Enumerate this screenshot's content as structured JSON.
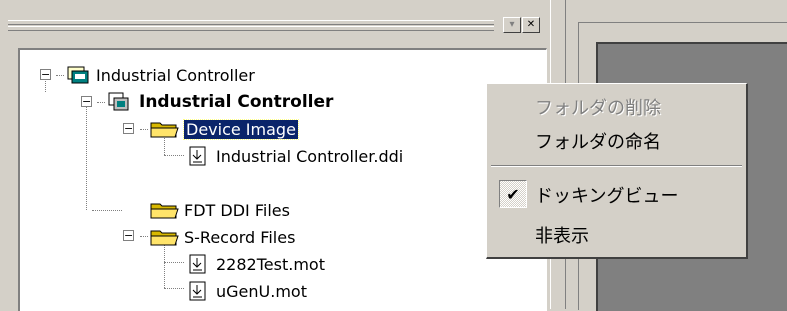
{
  "tree": {
    "nodes": [
      {
        "label": "Industrial Controller",
        "expander": "−"
      },
      {
        "label": "Industrial Controller",
        "expander": "−"
      },
      {
        "label": "Device Image",
        "expander": "−"
      },
      {
        "label": "Industrial Controller.ddi"
      },
      {
        "label": "FDT DDI Files"
      },
      {
        "label": "S-Record Files",
        "expander": "−"
      },
      {
        "label": "2282Test.mot"
      },
      {
        "label": "uGenU.mot"
      }
    ]
  },
  "panel": {
    "dropdown_glyph": "▾",
    "close_glyph": "✕"
  },
  "context_menu": {
    "items": [
      {
        "label": "フォルダの削除",
        "enabled": false
      },
      {
        "label": "フォルダの命名",
        "enabled": true
      },
      {
        "label": "ドッキングビュー",
        "enabled": true,
        "checked": true,
        "check_glyph": "✔"
      },
      {
        "label": "非表示",
        "enabled": true
      }
    ]
  },
  "colors": {
    "selection": "#0a246a",
    "face": "#d4d0c8",
    "workspace": "#808080"
  }
}
